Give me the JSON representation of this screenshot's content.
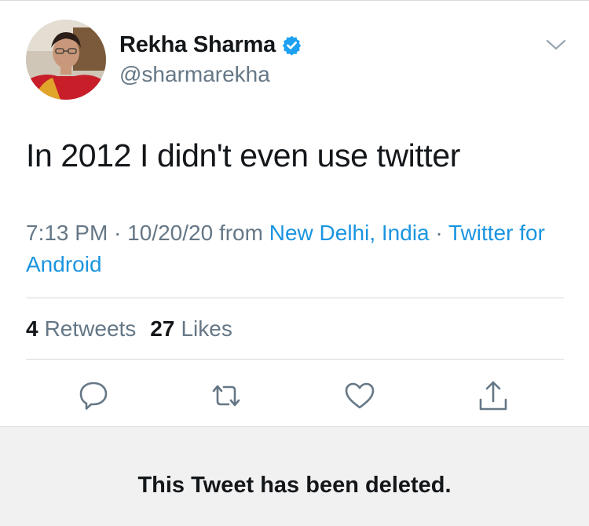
{
  "tweet": {
    "author": {
      "display_name": "Rekha Sharma",
      "handle": "@sharmarekha",
      "verified": true,
      "verified_icon": "verified-badge-icon",
      "avatar_icon": "avatar-photo"
    },
    "text": "In 2012 I didn't even use twitter",
    "meta": {
      "time": "7:13 PM",
      "sep1": " · ",
      "date": "10/20/20",
      "from_label": " from ",
      "location": "New Delhi, India",
      "sep2": " · ",
      "source": "Twitter for Android"
    },
    "stats": {
      "retweets_count": "4",
      "retweets_label": "Retweets",
      "likes_count": "27",
      "likes_label": "Likes"
    },
    "actions": [
      "reply-icon",
      "retweet-icon",
      "like-icon",
      "share-icon"
    ],
    "menu_icon": "chevron-down-icon"
  },
  "notice": {
    "text": "This Tweet has been deleted."
  },
  "colors": {
    "link": "#1b95e0",
    "muted": "#657786",
    "text": "#14171a",
    "verified": "#1da1f2",
    "notice_bg": "#f1f1f2"
  }
}
